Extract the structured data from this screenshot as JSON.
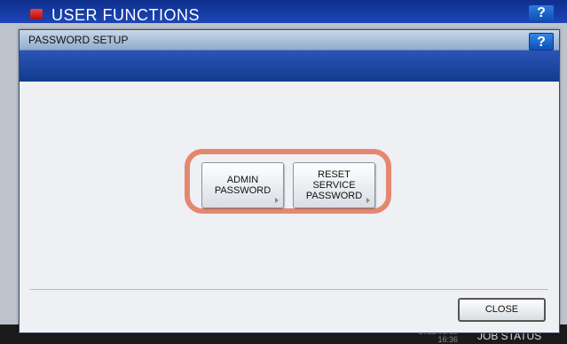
{
  "background_screen": {
    "title": "USER FUNCTIONS",
    "help_label": "?",
    "datetime_line1": "2011/03/15",
    "datetime_line2": "16:36",
    "job_status_label": "JOB STATUS"
  },
  "dialog": {
    "title": "PASSWORD SETUP",
    "help_label": "?",
    "buttons": [
      {
        "label": "ADMIN\nPASSWORD"
      },
      {
        "label": "RESET\nSERVICE\nPASSWORD"
      }
    ],
    "close_label": "CLOSE"
  },
  "colors": {
    "highlight": "#e58770",
    "header_band": "#1c45b8"
  },
  "icons": [
    "user-functions-icon",
    "submenu-arrow-icon"
  ]
}
